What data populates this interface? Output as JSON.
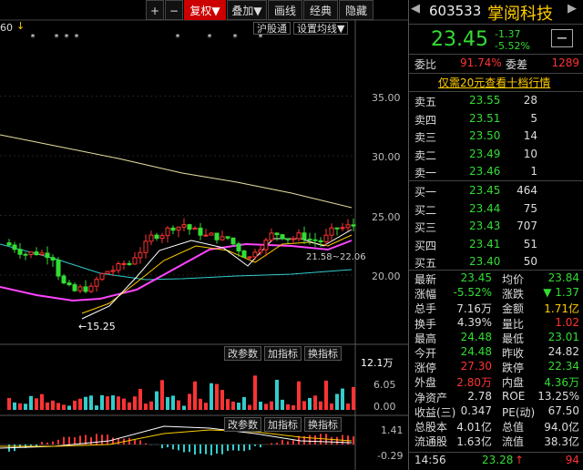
{
  "toolbar": {
    "plus": "+",
    "minus": "−",
    "fuquan": "复权",
    "fuquan_arrow": "▼",
    "overlay": "叠加",
    "overlay_arrow": "▼",
    "draw": "画线",
    "classic": "经典",
    "hide": "隐藏"
  },
  "left_corner_number": "60",
  "ma_bar": {
    "hgt": "沪股通",
    "set_ma": "设置均线",
    "arrow": "▼"
  },
  "price_axis": [
    "35.00",
    "30.00",
    "25.00",
    "20.00"
  ],
  "annotations": {
    "low": "15.25",
    "ma_label": "21.58~22.06"
  },
  "volume": {
    "buttons": [
      "改参数",
      "加指标",
      "换指标"
    ],
    "axis": [
      "12.1万",
      "6.05",
      "0.00"
    ],
    "unit": "万"
  },
  "macd": {
    "buttons": [
      "改参数",
      "加指标",
      "换指标"
    ],
    "axis": [
      "1.41",
      "-0.29"
    ]
  },
  "stock": {
    "code": "603533",
    "name": "掌阅科技",
    "price": "23.45",
    "change": "-1.37",
    "change_pct": "-5.52%",
    "box_icon": "−"
  },
  "weibi": {
    "label1": "委比",
    "value1": "91.74%",
    "label2": "委差",
    "value2": "1289"
  },
  "promo": "仅需20元查看十档行情",
  "asks": [
    {
      "label": "卖五",
      "price": "23.55",
      "vol": "28"
    },
    {
      "label": "卖四",
      "price": "23.51",
      "vol": "5"
    },
    {
      "label": "卖三",
      "price": "23.50",
      "vol": "14"
    },
    {
      "label": "卖二",
      "price": "23.49",
      "vol": "10"
    },
    {
      "label": "卖一",
      "price": "23.46",
      "vol": "1"
    }
  ],
  "bids": [
    {
      "label": "买一",
      "price": "23.45",
      "vol": "464"
    },
    {
      "label": "买二",
      "price": "23.44",
      "vol": "75"
    },
    {
      "label": "买三",
      "price": "23.43",
      "vol": "707"
    },
    {
      "label": "买四",
      "price": "23.41",
      "vol": "51"
    },
    {
      "label": "买五",
      "price": "23.40",
      "vol": "50"
    }
  ],
  "stats": [
    {
      "l1": "最新",
      "v1": "23.45",
      "c1": "dn",
      "l2": "均价",
      "v2": "23.84",
      "c2": "dn"
    },
    {
      "l1": "涨幅",
      "v1": "-5.52%",
      "c1": "dn",
      "l2": "涨跌",
      "v2": "▼ 1.37",
      "c2": "dn"
    },
    {
      "l1": "总手",
      "v1": "7.16万",
      "c1": "wh",
      "l2": "金额",
      "v2": "1.71亿",
      "c2": "yel"
    },
    {
      "l1": "换手",
      "v1": "4.39%",
      "c1": "wh",
      "l2": "量比",
      "v2": "1.02",
      "c2": "up"
    },
    {
      "l1": "最高",
      "v1": "24.48",
      "c1": "dn",
      "l2": "最低",
      "v2": "23.01",
      "c2": "dn"
    },
    {
      "l1": "今开",
      "v1": "24.48",
      "c1": "dn",
      "l2": "昨收",
      "v2": "24.82",
      "c2": "wh"
    },
    {
      "l1": "涨停",
      "v1": "27.30",
      "c1": "up",
      "l2": "跌停",
      "v2": "22.34",
      "c2": "dn"
    },
    {
      "l1": "外盘",
      "v1": "2.80万",
      "c1": "up",
      "l2": "内盘",
      "v2": "4.36万",
      "c2": "dn"
    },
    {
      "l1": "净资产",
      "v1": "2.78",
      "c1": "wh",
      "l2": "ROE",
      "v2": "13.25%",
      "c2": "wh"
    },
    {
      "l1": "收益(三)",
      "v1": "0.347",
      "c1": "wh",
      "l2": "PE(动)",
      "v2": "67.50",
      "c2": "wh"
    },
    {
      "l1": "总股本",
      "v1": "4.01亿",
      "c1": "wh",
      "l2": "总值",
      "v2": "94.0亿",
      "c2": "wh"
    },
    {
      "l1": "流通股",
      "v1": "1.63亿",
      "c1": "wh",
      "l2": "流值",
      "v2": "38.3亿",
      "c2": "wh"
    }
  ],
  "tick": {
    "time": "14:56",
    "price": "23.28",
    "arrow": "↑",
    "vol": "94"
  },
  "colors": {
    "up": "#ff3333",
    "down": "#33dd33",
    "ma5": "#ffffff",
    "ma10": "#ffcc00",
    "ma20": "#ff44ff",
    "ma60": "#33cccc",
    "ma120": "#e8e0a0"
  }
}
